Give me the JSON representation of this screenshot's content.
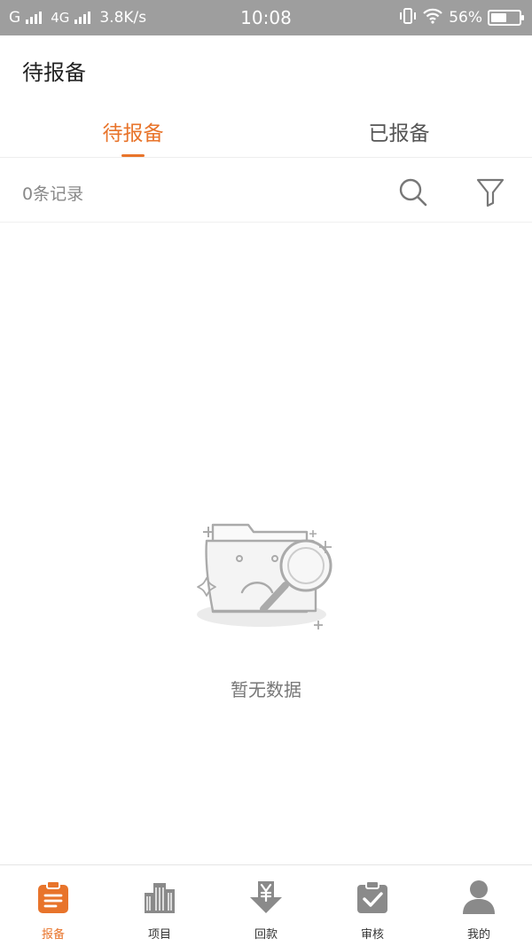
{
  "status_bar": {
    "carrier1": "G",
    "carrier2": "4G",
    "net_speed": "3.8K/s",
    "time": "10:08",
    "battery_percent": "56%",
    "battery_level": 0.56
  },
  "header": {
    "title": "待报备"
  },
  "tabs": [
    {
      "label": "待报备",
      "active": true
    },
    {
      "label": "已报备",
      "active": false
    }
  ],
  "records": {
    "count_text": "0条记录"
  },
  "toolbar": {
    "search_icon": "search-icon",
    "filter_icon": "filter-icon"
  },
  "empty_state": {
    "text": "暂无数据"
  },
  "bottom_nav": {
    "items": [
      {
        "label": "报备",
        "icon": "clipboard-icon",
        "active": true
      },
      {
        "label": "项目",
        "icon": "building-icon",
        "active": false
      },
      {
        "label": "回款",
        "icon": "yen-download-icon",
        "active": false
      },
      {
        "label": "审核",
        "icon": "clipboard-check-icon",
        "active": false
      },
      {
        "label": "我的",
        "icon": "user-icon",
        "active": false
      }
    ]
  },
  "colors": {
    "accent": "#e8742b",
    "inactive_icon": "#8a8a8a",
    "status_bar_bg": "#9e9e9e"
  }
}
